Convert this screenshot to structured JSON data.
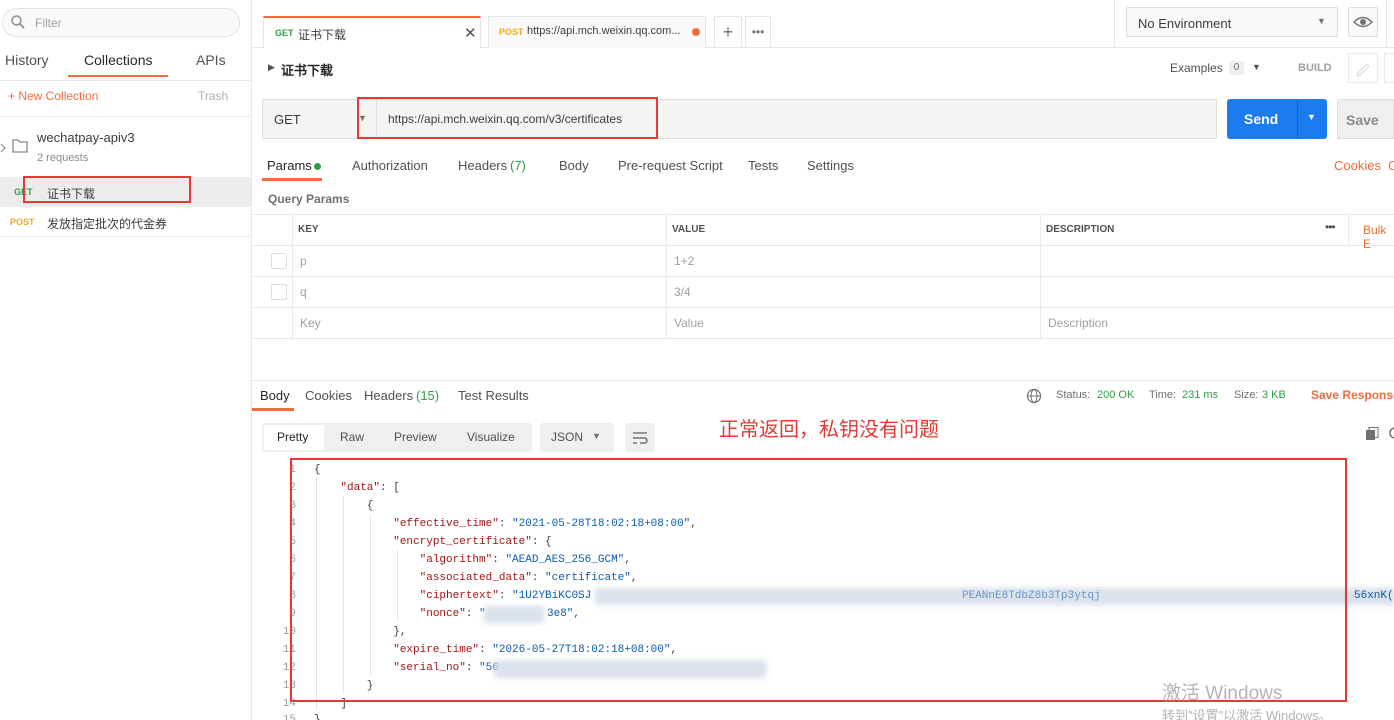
{
  "sidebar": {
    "filter_placeholder": "Filter",
    "tabs": [
      "History",
      "Collections",
      "APIs"
    ],
    "new_collection": "+ New Collection",
    "trash": "Trash",
    "collection": {
      "name": "wechatpay-apiv3",
      "count": "2 requests"
    },
    "requests": [
      {
        "method": "GET",
        "name": "证书下载"
      },
      {
        "method": "POST",
        "name": "发放指定批次的代金券"
      }
    ]
  },
  "tabs": [
    {
      "method": "GET",
      "label": "证书下载"
    },
    {
      "method": "POST",
      "label": "https://api.mch.weixin.qq.com..."
    }
  ],
  "environment": "No Environment",
  "request": {
    "title": "证书下载",
    "examples_label": "Examples",
    "examples_count": "0",
    "build": "BUILD",
    "method": "GET",
    "url": "https://api.mch.weixin.qq.com/v3/certificates",
    "send": "Send",
    "save": "Save",
    "tabs": [
      "Params",
      "Authorization",
      "Headers",
      "(7)",
      "Body",
      "Pre-request Script",
      "Tests",
      "Settings"
    ],
    "cookies": "Cookies",
    "cookies_cut": "C",
    "query_params_label": "Query Params",
    "columns": {
      "key": "KEY",
      "value": "VALUE",
      "description": "DESCRIPTION"
    },
    "bulk_edit": "Bulk E",
    "params": [
      {
        "key": "p",
        "value": "1+2"
      },
      {
        "key": "q",
        "value": "3/4"
      }
    ],
    "placeholder": {
      "key": "Key",
      "value": "Value",
      "description": "Description"
    }
  },
  "response": {
    "tabs": [
      "Body",
      "Cookies",
      "Headers",
      "(15)",
      "Test Results"
    ],
    "status_label": "Status:",
    "status": "200 OK",
    "time_label": "Time:",
    "time": "231 ms",
    "size_label": "Size:",
    "size": "3 KB",
    "save_response": "Save Response",
    "view_modes": [
      "Pretty",
      "Raw",
      "Preview",
      "Visualize"
    ],
    "format": "JSON",
    "annotation": "正常返回，私钥没有问题",
    "line_numbers": [
      "1",
      "2",
      "3",
      "4",
      "5",
      "6",
      "7",
      "8",
      "9",
      "10",
      "11",
      "12",
      "13",
      "14",
      "15"
    ],
    "code_lines": [
      "{",
      "    \"data\": [",
      "        {",
      "            \"effective_time\": \"2021-05-28T18:02:18+08:00\",",
      "            \"encrypt_certificate\": {",
      "                \"algorithm\": \"AEAD_AES_256_GCM\",",
      "                \"associated_data\": \"certificate\",",
      "                \"ciphertext\": \"1U2YBiKC0SJ",
      "                \"nonce\": \"",
      "            },",
      "            \"expire_time\": \"2026-05-27T18:02:18+08:00\",",
      "            \"serial_no\": \"56",
      "        }",
      "    ]",
      "}"
    ],
    "nonce_tail": "3e8\",",
    "ciphertext_tail": "56xnK(",
    "ciphertext_mid": "PEANnE8TdbZ8b3Tp3ytqj"
  },
  "watermark": {
    "line1": "激活 Windows",
    "line2": "转到\"设置\"以激活 Windows。"
  }
}
